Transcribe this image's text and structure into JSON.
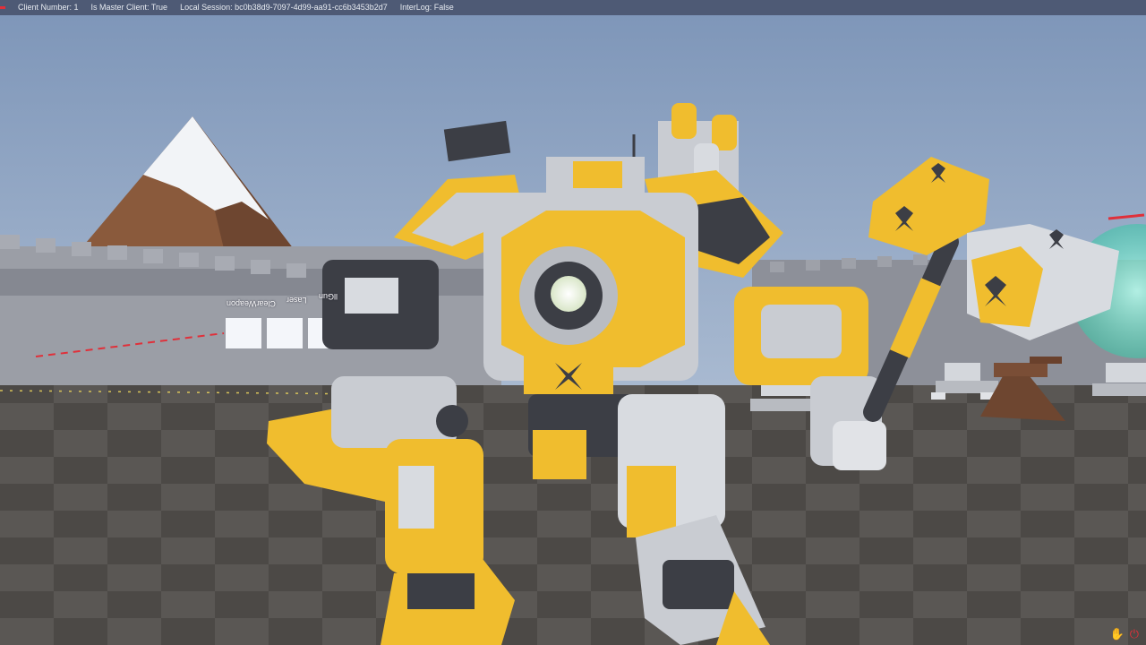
{
  "debug": {
    "client_number": "Client Number: 1",
    "is_master": "Is Master Client: True",
    "session": "Local Session: bc0b38d9-7097-4d99-aa91-cc6b3453b2d7",
    "interlog": "InterLog: False"
  },
  "weapon_signs": [
    "ClearWeapon",
    "Laser",
    "llGun"
  ],
  "hud_icons": [
    "hand-icon",
    "power-icon"
  ],
  "colors": {
    "sky": "#8aa2c4",
    "floor": "#55524f",
    "mech_yellow": "#f0bd2e",
    "mech_gray": "#c9ccd2",
    "mech_dark": "#3c3e45",
    "mountain": "#8a5a3c",
    "snow": "#f2f4f7",
    "wall": "#9b9ea6",
    "energy": "#6fe0c6",
    "status_red": "#e0303a"
  }
}
